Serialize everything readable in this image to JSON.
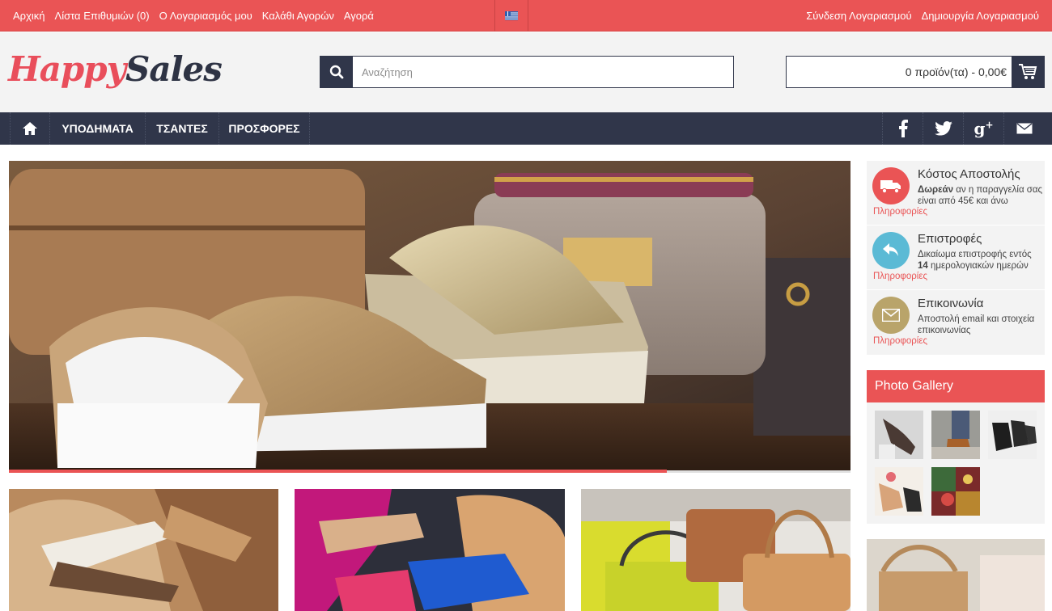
{
  "topbar": {
    "links": [
      "Αρχική",
      "Λίστα Επιθυμιών (0)",
      "Ο Λογαριασμός μου",
      "Καλάθι Αγορών",
      "Αγορά"
    ],
    "login": "Σύνδεση Λογαριασμού",
    "register": "Δημιουργία Λογαριασμού"
  },
  "header": {
    "logo_part1": "Happy",
    "logo_part2": "Sales",
    "search_placeholder": "Αναζήτηση",
    "cart_text": "0 προϊόν(τα) - 0,00€"
  },
  "nav": {
    "items": [
      "ΥΠΟΔΗΜΑΤΑ",
      "ΤΣΑΝΤΕΣ",
      "ΠΡΟΣΦΟΡΕΣ"
    ],
    "social": [
      "facebook-icon",
      "twitter-icon",
      "google-plus-icon",
      "mail-icon"
    ]
  },
  "sidebar": {
    "shipping": {
      "title": "Κόστος Αποστολής",
      "desc_bold": "Δωρεάν",
      "desc_rest": " αν η παραγγελία σας είναι από 45€ και άνω",
      "more": "Πληροφορίες",
      "color": "#ea5455"
    },
    "returns": {
      "title": "Επιστροφές",
      "desc_pre": "Δικαίωμα επιστροφής εντός ",
      "desc_bold": "14",
      "desc_post": " ημερολογιακών ημερών",
      "more": "Πληροφορίες",
      "color": "#5bbad5"
    },
    "contact": {
      "title": "Επικοινωνία",
      "desc": "Αποστολή email και στοιχεία επικοινωνίας",
      "more": "Πληροφορίες",
      "color": "#b9a46a"
    },
    "gallery_title": "Photo Gallery"
  },
  "colors": {
    "accent": "#ea5455",
    "dark": "#30364a",
    "light_bg": "#f3f3f3"
  }
}
